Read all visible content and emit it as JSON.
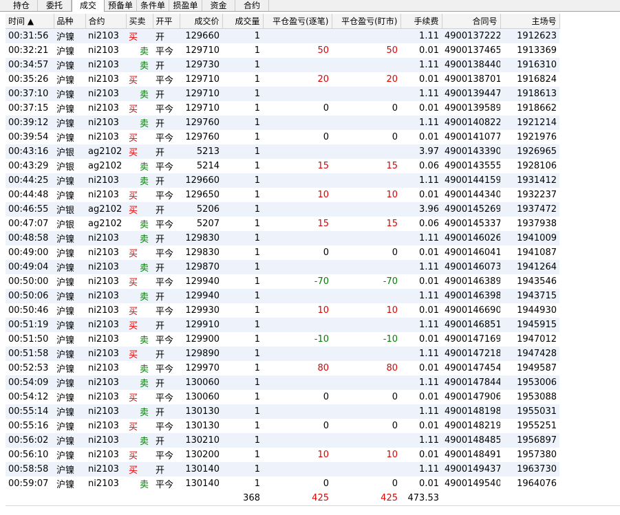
{
  "tabs": [
    "持仓",
    "委托",
    "成交",
    "预备单",
    "条件单",
    "损盈单",
    "资金",
    "合约"
  ],
  "active_tab": "成交",
  "columns": [
    "时间 ▲",
    "品种",
    "合约",
    "买卖",
    "开平",
    "成交价",
    "成交量",
    "平仓盈亏(逐笔)",
    "平仓盈亏(盯市)",
    "手续费",
    "合同号",
    "主场号"
  ],
  "colors": {
    "buy": "#e00000",
    "sell": "#008000",
    "row_alt": "#eef3fb"
  },
  "rows": [
    [
      "00:31:56",
      "沪镍",
      "ni2103",
      "买",
      "开",
      "129660",
      "1",
      "",
      "",
      "1.11",
      "4900137222",
      "1912623"
    ],
    [
      "00:32:21",
      "沪镍",
      "ni2103",
      "卖",
      "平今",
      "129710",
      "1",
      "50",
      "50",
      "0.01",
      "4900137465",
      "1913369"
    ],
    [
      "00:34:57",
      "沪镍",
      "ni2103",
      "卖",
      "开",
      "129730",
      "1",
      "",
      "",
      "1.11",
      "4900138440",
      "1916310"
    ],
    [
      "00:35:26",
      "沪镍",
      "ni2103",
      "买",
      "平今",
      "129710",
      "1",
      "20",
      "20",
      "0.01",
      "4900138701",
      "1916824"
    ],
    [
      "00:37:10",
      "沪镍",
      "ni2103",
      "卖",
      "开",
      "129710",
      "1",
      "",
      "",
      "1.11",
      "4900139447",
      "1918613"
    ],
    [
      "00:37:15",
      "沪镍",
      "ni2103",
      "买",
      "平今",
      "129710",
      "1",
      "0",
      "0",
      "0.01",
      "4900139589",
      "1918662"
    ],
    [
      "00:39:12",
      "沪镍",
      "ni2103",
      "卖",
      "开",
      "129760",
      "1",
      "",
      "",
      "1.11",
      "4900140822",
      "1921214"
    ],
    [
      "00:39:54",
      "沪镍",
      "ni2103",
      "买",
      "平今",
      "129760",
      "1",
      "0",
      "0",
      "0.01",
      "4900141077",
      "1921976"
    ],
    [
      "00:43:16",
      "沪银",
      "ag2102",
      "买",
      "开",
      "5213",
      "1",
      "",
      "",
      "3.97",
      "4900143390",
      "1926965"
    ],
    [
      "00:43:29",
      "沪银",
      "ag2102",
      "卖",
      "平今",
      "5214",
      "1",
      "15",
      "15",
      "0.06",
      "4900143555",
      "1928106"
    ],
    [
      "00:44:25",
      "沪镍",
      "ni2103",
      "卖",
      "开",
      "129660",
      "1",
      "",
      "",
      "1.11",
      "4900144159",
      "1931412"
    ],
    [
      "00:44:48",
      "沪镍",
      "ni2103",
      "买",
      "平今",
      "129650",
      "1",
      "10",
      "10",
      "0.01",
      "4900144340",
      "1932237"
    ],
    [
      "00:46:55",
      "沪银",
      "ag2102",
      "买",
      "开",
      "5206",
      "1",
      "",
      "",
      "3.96",
      "4900145269",
      "1937472"
    ],
    [
      "00:47:07",
      "沪银",
      "ag2102",
      "卖",
      "平今",
      "5207",
      "1",
      "15",
      "15",
      "0.06",
      "4900145337",
      "1937938"
    ],
    [
      "00:48:58",
      "沪镍",
      "ni2103",
      "卖",
      "开",
      "129830",
      "1",
      "",
      "",
      "1.11",
      "4900146026",
      "1941009"
    ],
    [
      "00:49:00",
      "沪镍",
      "ni2103",
      "买",
      "平今",
      "129830",
      "1",
      "0",
      "0",
      "0.01",
      "4900146041",
      "1941087"
    ],
    [
      "00:49:04",
      "沪镍",
      "ni2103",
      "卖",
      "开",
      "129870",
      "1",
      "",
      "",
      "1.11",
      "4900146073",
      "1941264"
    ],
    [
      "00:50:00",
      "沪镍",
      "ni2103",
      "买",
      "平今",
      "129940",
      "1",
      "-70",
      "-70",
      "0.01",
      "4900146389",
      "1943546"
    ],
    [
      "00:50:06",
      "沪镍",
      "ni2103",
      "卖",
      "开",
      "129940",
      "1",
      "",
      "",
      "1.11",
      "4900146398",
      "1943715"
    ],
    [
      "00:50:46",
      "沪镍",
      "ni2103",
      "买",
      "平今",
      "129930",
      "1",
      "10",
      "10",
      "0.01",
      "4900146690",
      "1944930"
    ],
    [
      "00:51:19",
      "沪镍",
      "ni2103",
      "买",
      "开",
      "129910",
      "1",
      "",
      "",
      "1.11",
      "4900146851",
      "1945915"
    ],
    [
      "00:51:50",
      "沪镍",
      "ni2103",
      "卖",
      "平今",
      "129900",
      "1",
      "-10",
      "-10",
      "0.01",
      "4900147169",
      "1947012"
    ],
    [
      "00:51:58",
      "沪镍",
      "ni2103",
      "买",
      "开",
      "129890",
      "1",
      "",
      "",
      "1.11",
      "4900147218",
      "1947428"
    ],
    [
      "00:52:53",
      "沪镍",
      "ni2103",
      "卖",
      "平今",
      "129970",
      "1",
      "80",
      "80",
      "0.01",
      "4900147454",
      "1949587"
    ],
    [
      "00:54:09",
      "沪镍",
      "ni2103",
      "卖",
      "开",
      "130060",
      "1",
      "",
      "",
      "1.11",
      "4900147844",
      "1953006"
    ],
    [
      "00:54:12",
      "沪镍",
      "ni2103",
      "买",
      "平今",
      "130060",
      "1",
      "0",
      "0",
      "0.01",
      "4900147906",
      "1953088"
    ],
    [
      "00:55:14",
      "沪镍",
      "ni2103",
      "卖",
      "开",
      "130130",
      "1",
      "",
      "",
      "1.11",
      "4900148198",
      "1955031"
    ],
    [
      "00:55:16",
      "沪镍",
      "ni2103",
      "买",
      "平今",
      "130130",
      "1",
      "0",
      "0",
      "0.01",
      "4900148219",
      "1955251"
    ],
    [
      "00:56:02",
      "沪镍",
      "ni2103",
      "卖",
      "开",
      "130210",
      "1",
      "",
      "",
      "1.11",
      "4900148485",
      "1956897"
    ],
    [
      "00:56:10",
      "沪镍",
      "ni2103",
      "买",
      "平今",
      "130200",
      "1",
      "10",
      "10",
      "0.01",
      "4900148491",
      "1957380"
    ],
    [
      "00:58:58",
      "沪镍",
      "ni2103",
      "买",
      "开",
      "130140",
      "1",
      "",
      "",
      "1.11",
      "4900149437",
      "1963730"
    ],
    [
      "00:59:07",
      "沪镍",
      "ni2103",
      "卖",
      "平今",
      "130140",
      "1",
      "0",
      "0",
      "0.01",
      "4900149540",
      "1964076"
    ]
  ],
  "summary": {
    "volume": "368",
    "pnl_trade": "425",
    "pnl_mark": "425",
    "fee": "473.53"
  }
}
